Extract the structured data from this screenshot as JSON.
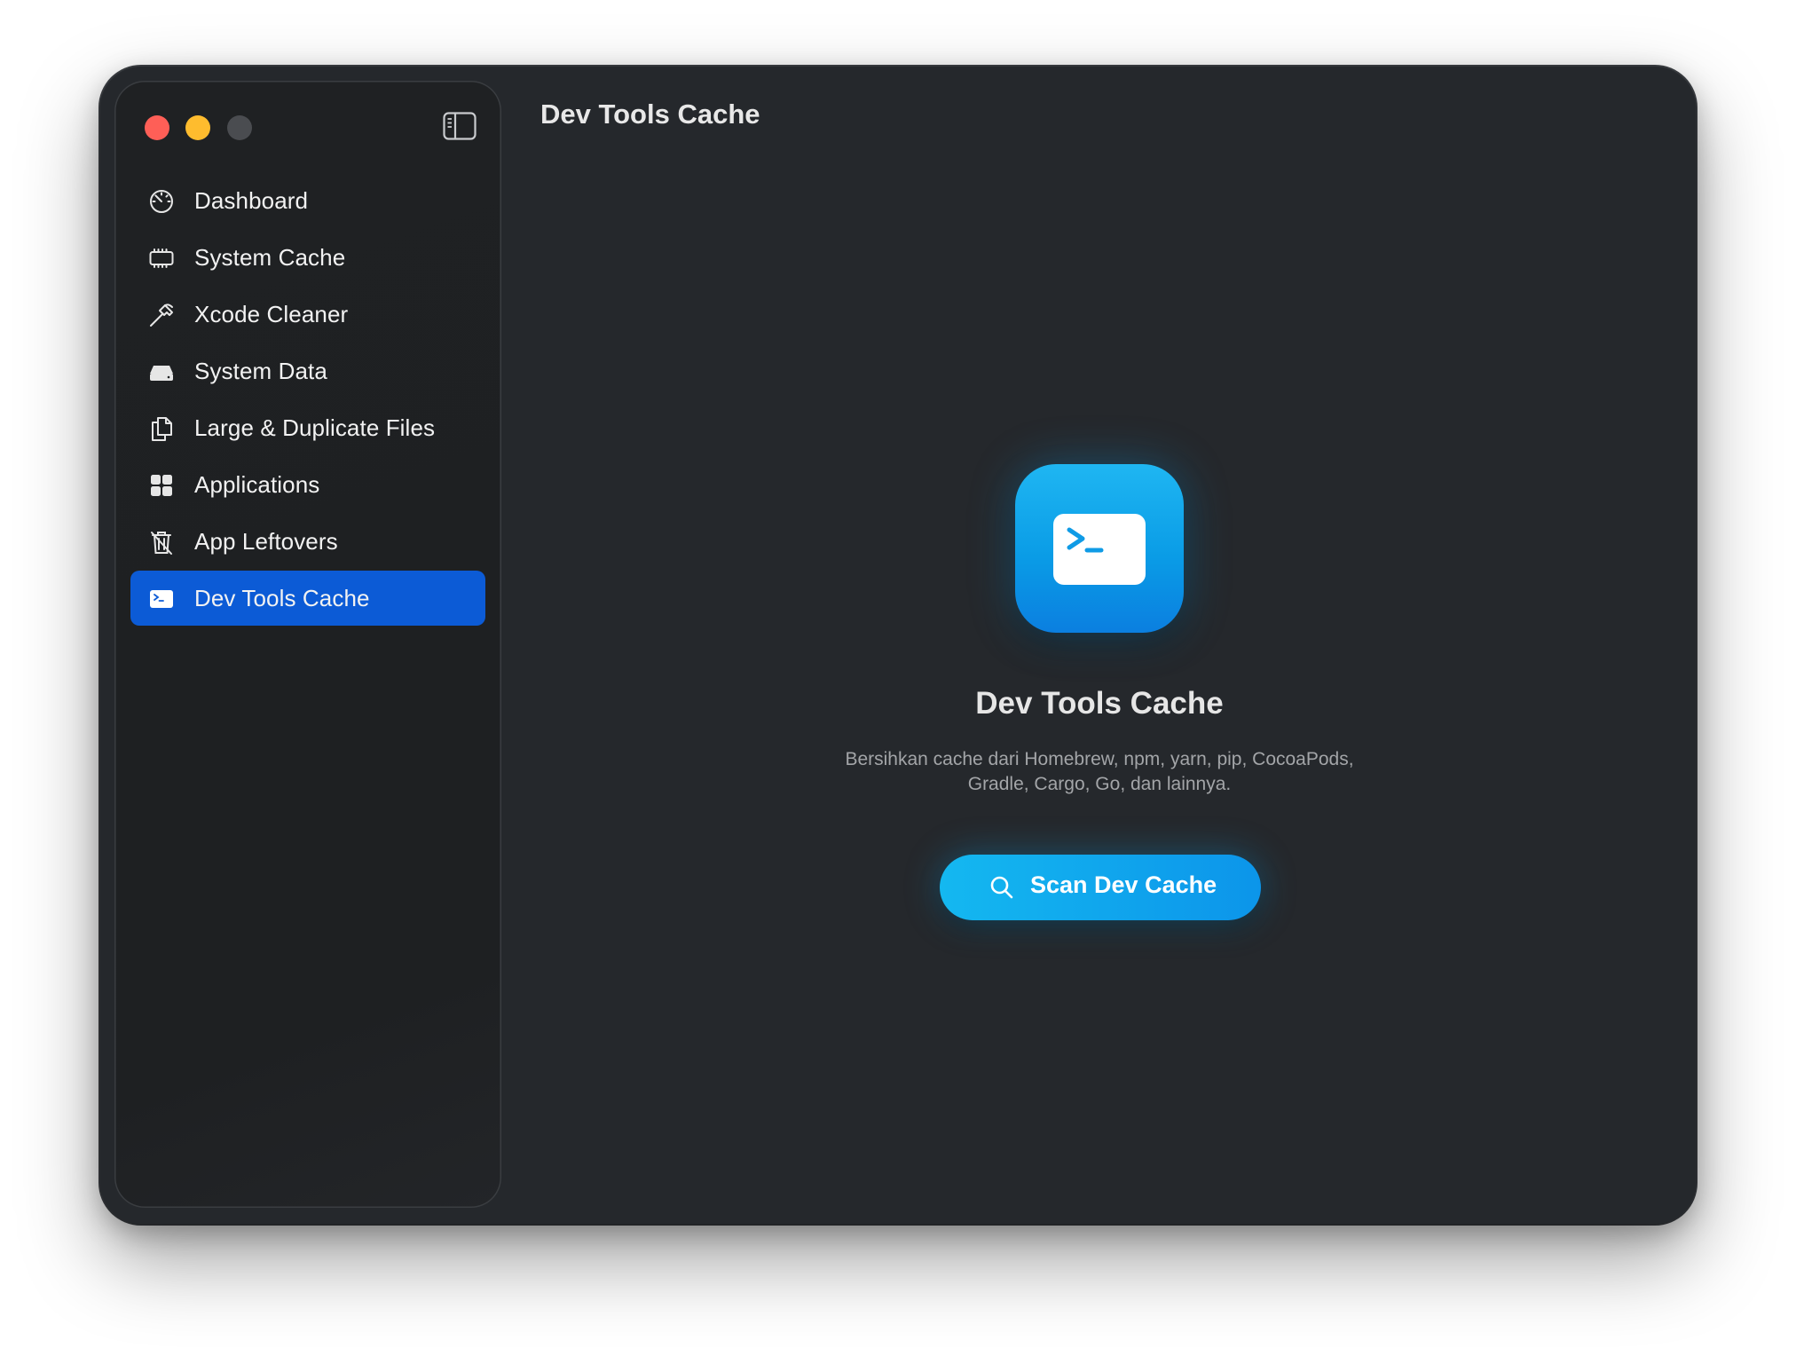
{
  "window": {
    "title": "Dev Tools Cache"
  },
  "sidebar": {
    "items": [
      {
        "label": "Dashboard",
        "icon": "gauge-icon",
        "active": false
      },
      {
        "label": "System Cache",
        "icon": "memory-chip-icon",
        "active": false
      },
      {
        "label": "Xcode Cleaner",
        "icon": "hammer-icon",
        "active": false
      },
      {
        "label": "System Data",
        "icon": "internal-drive-icon",
        "active": false
      },
      {
        "label": "Large & Duplicate Files",
        "icon": "documents-icon",
        "active": false
      },
      {
        "label": "Applications",
        "icon": "app-grid-icon",
        "active": false
      },
      {
        "label": "App Leftovers",
        "icon": "trash-slash-icon",
        "active": false
      },
      {
        "label": "Dev Tools Cache",
        "icon": "terminal-icon",
        "active": true
      }
    ]
  },
  "main": {
    "title": "Dev Tools Cache",
    "hero": {
      "icon": "terminal-icon",
      "title": "Dev Tools Cache",
      "description_line1": "Bersihkan cache dari Homebrew, npm, yarn, pip, CocoaPods,",
      "description_line2": "Gradle, Cargo, Go, dan lainnya."
    },
    "scan_button": {
      "label": "Scan Dev Cache",
      "icon": "search-icon"
    }
  },
  "colors": {
    "window_bg": "#25282c",
    "sidebar_bg": "#1f2123",
    "selection": "#0c5bd6",
    "accent": "#14b8f0",
    "close": "#fe5f57",
    "minimize": "#febc2e",
    "zoom_disabled": "#4a4c50"
  }
}
